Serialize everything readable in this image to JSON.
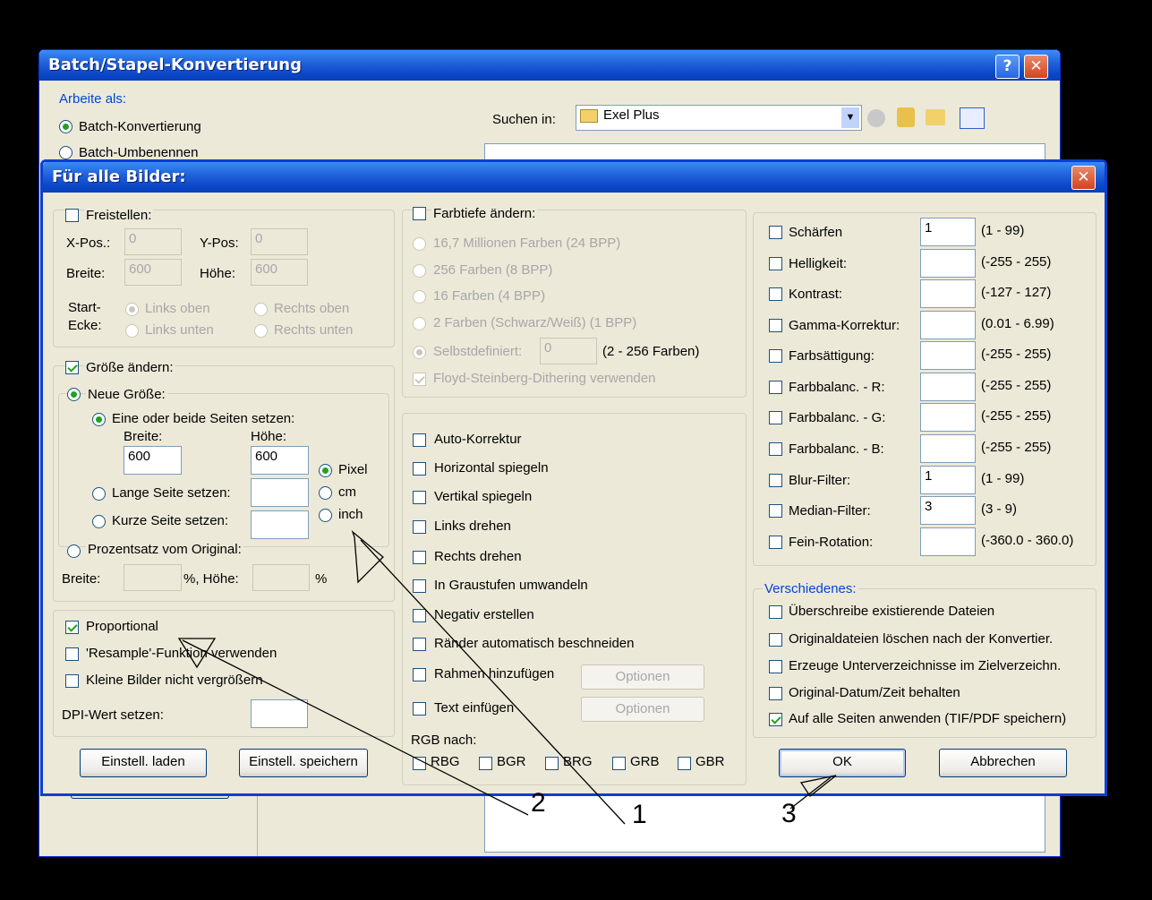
{
  "bg_window": {
    "title": "Batch/Stapel-Konvertierung",
    "arbeite_als": "Arbeite als:",
    "mode_batch": "Batch-Konvertierung",
    "mode_rename": "Batch-Umbenennen",
    "suchen_in": "Suchen in:",
    "folder": "Exel Plus",
    "help": "?",
    "close": "✕"
  },
  "dialog": {
    "title": "Für alle Bilder:",
    "close": "✕",
    "freistellen": {
      "title": "Freistellen:",
      "xpos_label": "X-Pos.:",
      "xpos": "0",
      "ypos_label": "Y-Pos:",
      "ypos": "0",
      "breite_label": "Breite:",
      "breite": "600",
      "hoehe_label": "Höhe:",
      "hoehe": "600",
      "start_label_1": "Start-",
      "start_label_2": "Ecke:",
      "links_oben": "Links oben",
      "rechts_oben": "Rechts oben",
      "links_unten": "Links unten",
      "rechts_unten": "Rechts unten"
    },
    "groesse": {
      "title": "Größe ändern:",
      "neue_groesse": "Neue Größe:",
      "eine_oder_beide": "Eine oder beide Seiten setzen:",
      "breite_label": "Breite:",
      "breite": "600",
      "hoehe_label": "Höhe:",
      "hoehe": "600",
      "lange_seite": "Lange Seite setzen:",
      "kurze_seite": "Kurze Seite setzen:",
      "pixel": "Pixel",
      "cm": "cm",
      "inch": "inch",
      "prozentsatz": "Prozentsatz vom Original:",
      "pct_breite_label": "Breite:",
      "pct_sep": "%, Höhe:",
      "pct_end": "%"
    },
    "proportional": "Proportional",
    "resample": "'Resample'-Funktion verwenden",
    "kleine_bilder": "Kleine Bilder nicht vergrößern",
    "dpi": "DPI-Wert setzen:",
    "btn_laden": "Einstell. laden",
    "btn_speichern": "Einstell. speichern",
    "farbtiefe": {
      "title": "Farbtiefe ändern:",
      "o1": "16,7 Millionen Farben (24 BPP)",
      "o2": "256 Farben (8 BPP)",
      "o3": "16 Farben (4 BPP)",
      "o4": "2 Farben (Schwarz/Weiß) (1 BPP)",
      "o5": "Selbstdefiniert:",
      "o5_value": "0",
      "o5_range": "(2 - 256 Farben)",
      "dither": "Floyd-Steinberg-Dithering verwenden"
    },
    "actions": [
      "Auto-Korrektur",
      "Horizontal spiegeln",
      "Vertikal spiegeln",
      "Links drehen",
      "Rechts drehen",
      "In Graustufen umwandeln",
      "Negativ erstellen",
      "Ränder automatisch beschneiden",
      "Rahmen hinzufügen",
      "Text einfügen"
    ],
    "optionen": "Optionen",
    "rgb_nach": "RGB nach:",
    "rgb": [
      "RBG",
      "BGR",
      "BRG",
      "GRB",
      "GBR"
    ],
    "filters": [
      {
        "label": "Schärfen",
        "value": "1",
        "range": "(1 - 99)"
      },
      {
        "label": "Helligkeit:",
        "value": "",
        "range": "(-255 - 255)"
      },
      {
        "label": "Kontrast:",
        "value": "",
        "range": "(-127 - 127)"
      },
      {
        "label": "Gamma-Korrektur:",
        "value": "",
        "range": "(0.01 - 6.99)"
      },
      {
        "label": "Farbsättigung:",
        "value": "",
        "range": "(-255 - 255)"
      },
      {
        "label": "Farbbalanc. - R:",
        "value": "",
        "range": "(-255 - 255)"
      },
      {
        "label": "Farbbalanc. - G:",
        "value": "",
        "range": "(-255 - 255)"
      },
      {
        "label": "Farbbalanc. - B:",
        "value": "",
        "range": "(-255 - 255)"
      },
      {
        "label": "Blur-Filter:",
        "value": "1",
        "range": "(1 - 99)"
      },
      {
        "label": "Median-Filter:",
        "value": "3",
        "range": "(3 - 9)"
      },
      {
        "label": "Fein-Rotation:",
        "value": "",
        "range": "(-360.0 - 360.0)"
      }
    ],
    "verschiedenes": {
      "title": "Verschiedenes:",
      "o1": "Überschreibe existierende Dateien",
      "o2": "Originaldateien löschen nach der Konvertier.",
      "o3": "Erzeuge Unterverzeichnisse im Zielverzeichn.",
      "o4": "Original-Datum/Zeit behalten",
      "o5": "Auf alle Seiten anwenden (TIF/PDF speichern)"
    },
    "ok": "OK",
    "abbrechen": "Abbrechen"
  },
  "annotations": {
    "a1": "1",
    "a2": "2",
    "a3": "3"
  }
}
